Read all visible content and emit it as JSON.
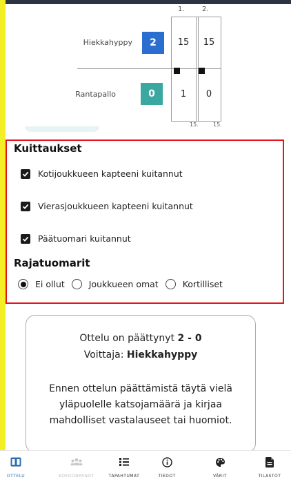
{
  "scoreboard": {
    "set_headers": [
      "1.",
      "2."
    ],
    "home": {
      "name": "Hiekkahyppy",
      "score": "2",
      "color": "#2a6fd0",
      "sets": [
        "15",
        "15"
      ]
    },
    "away": {
      "name": "Rantapallo",
      "score": "0",
      "color": "#3aa7a0",
      "sets": [
        "1",
        "0"
      ]
    },
    "bottom_labels": [
      "15.",
      "15."
    ]
  },
  "kuittaukset": {
    "title": "Kuittaukset",
    "items": [
      {
        "label": "Kotijoukkueen kapteeni kuitannut",
        "checked": true
      },
      {
        "label": "Vierasjoukkueen kapteeni kuitannut",
        "checked": true
      },
      {
        "label": "Päätuomari kuitannut",
        "checked": true
      }
    ]
  },
  "rajatuomarit": {
    "title": "Rajatuomarit",
    "options": [
      {
        "label": "Ei ollut",
        "selected": true
      },
      {
        "label": "Joukkueen omat",
        "selected": false
      },
      {
        "label": "Kortilliset",
        "selected": false
      }
    ]
  },
  "result_card": {
    "ended_prefix": "Ottelu on päättynyt",
    "ended_score": "2 - 0",
    "winner_prefix": "Voittaja:",
    "winner_name": "Hiekkahyppy",
    "instructions": [
      "Ennen ottelun päättämistä täytä vielä",
      "yläpuolelle katsojamäärä ja kirjaa",
      "mahdolliset vastalauseet tai huomiot."
    ]
  },
  "bottom_nav": [
    {
      "label": "OTTELU",
      "icon": "scoreboard-icon",
      "state": "active"
    },
    {
      "label": "KOKOONPANOT",
      "icon": "team-icon",
      "state": "disabled"
    },
    {
      "label": "TAPAHTUMAT",
      "icon": "list-icon",
      "state": "normal"
    },
    {
      "label": "TIEDOT",
      "icon": "info-icon",
      "state": "normal"
    },
    {
      "label": "VÄRIT",
      "icon": "palette-icon",
      "state": "normal"
    },
    {
      "label": "TILASTOT",
      "icon": "document-icon",
      "state": "normal"
    }
  ],
  "colors": {
    "accent": "#2a6fb0",
    "highlight_border": "#e3141b",
    "side_strip": "#f2ef27"
  }
}
